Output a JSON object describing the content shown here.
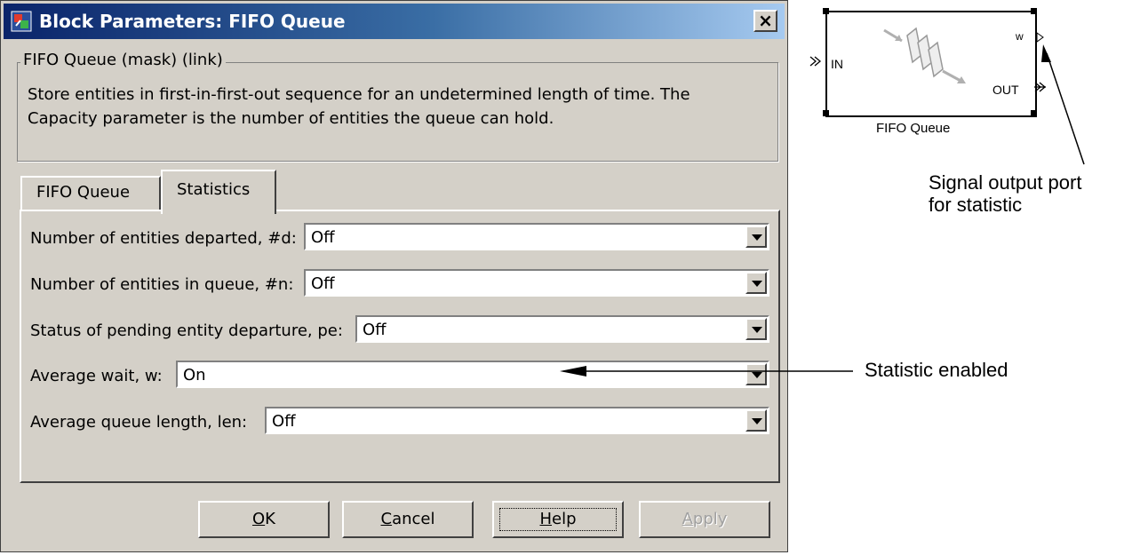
{
  "dialog": {
    "title": "Block Parameters: FIFO Queue",
    "close_label": "×",
    "mask_legend": "FIFO Queue (mask) (link)",
    "description_line1": "Store entities in first-in-first-out sequence for an undetermined length of time. The",
    "description_line2": "Capacity parameter is the number of entities the queue can hold.",
    "tabs": [
      {
        "label": "FIFO Queue",
        "active": false
      },
      {
        "label": "Statistics",
        "active": true
      }
    ],
    "parameters": [
      {
        "label": "Number of entities departed, #d:",
        "value": "Off"
      },
      {
        "label": "Number of entities in queue, #n:",
        "value": "Off"
      },
      {
        "label": "Status of pending entity departure, pe:",
        "value": "Off"
      },
      {
        "label": "Average wait, w:",
        "value": "On"
      },
      {
        "label": "Average queue length, len:",
        "value": "Off"
      }
    ],
    "buttons": {
      "ok": {
        "label": "OK",
        "mnemonic": "O",
        "rest": "K"
      },
      "cancel": {
        "label": "Cancel",
        "mnemonic": "C",
        "rest": "ancel"
      },
      "help": {
        "label": "Help",
        "mnemonic": "H",
        "rest": "elp"
      },
      "apply": {
        "label": "Apply",
        "mnemonic": "A",
        "rest": "pply",
        "enabled": false
      }
    }
  },
  "block": {
    "name": "FIFO Queue",
    "port_in": "IN",
    "port_out": "OUT",
    "port_w": "w"
  },
  "callouts": {
    "signal_port_line1": "Signal output port",
    "signal_port_line2": "for statistic",
    "statistic_enabled": "Statistic enabled"
  },
  "colors": {
    "dialog_bg": "#d4d0c8",
    "title_start": "#0a246a",
    "title_end": "#a6caf0"
  }
}
